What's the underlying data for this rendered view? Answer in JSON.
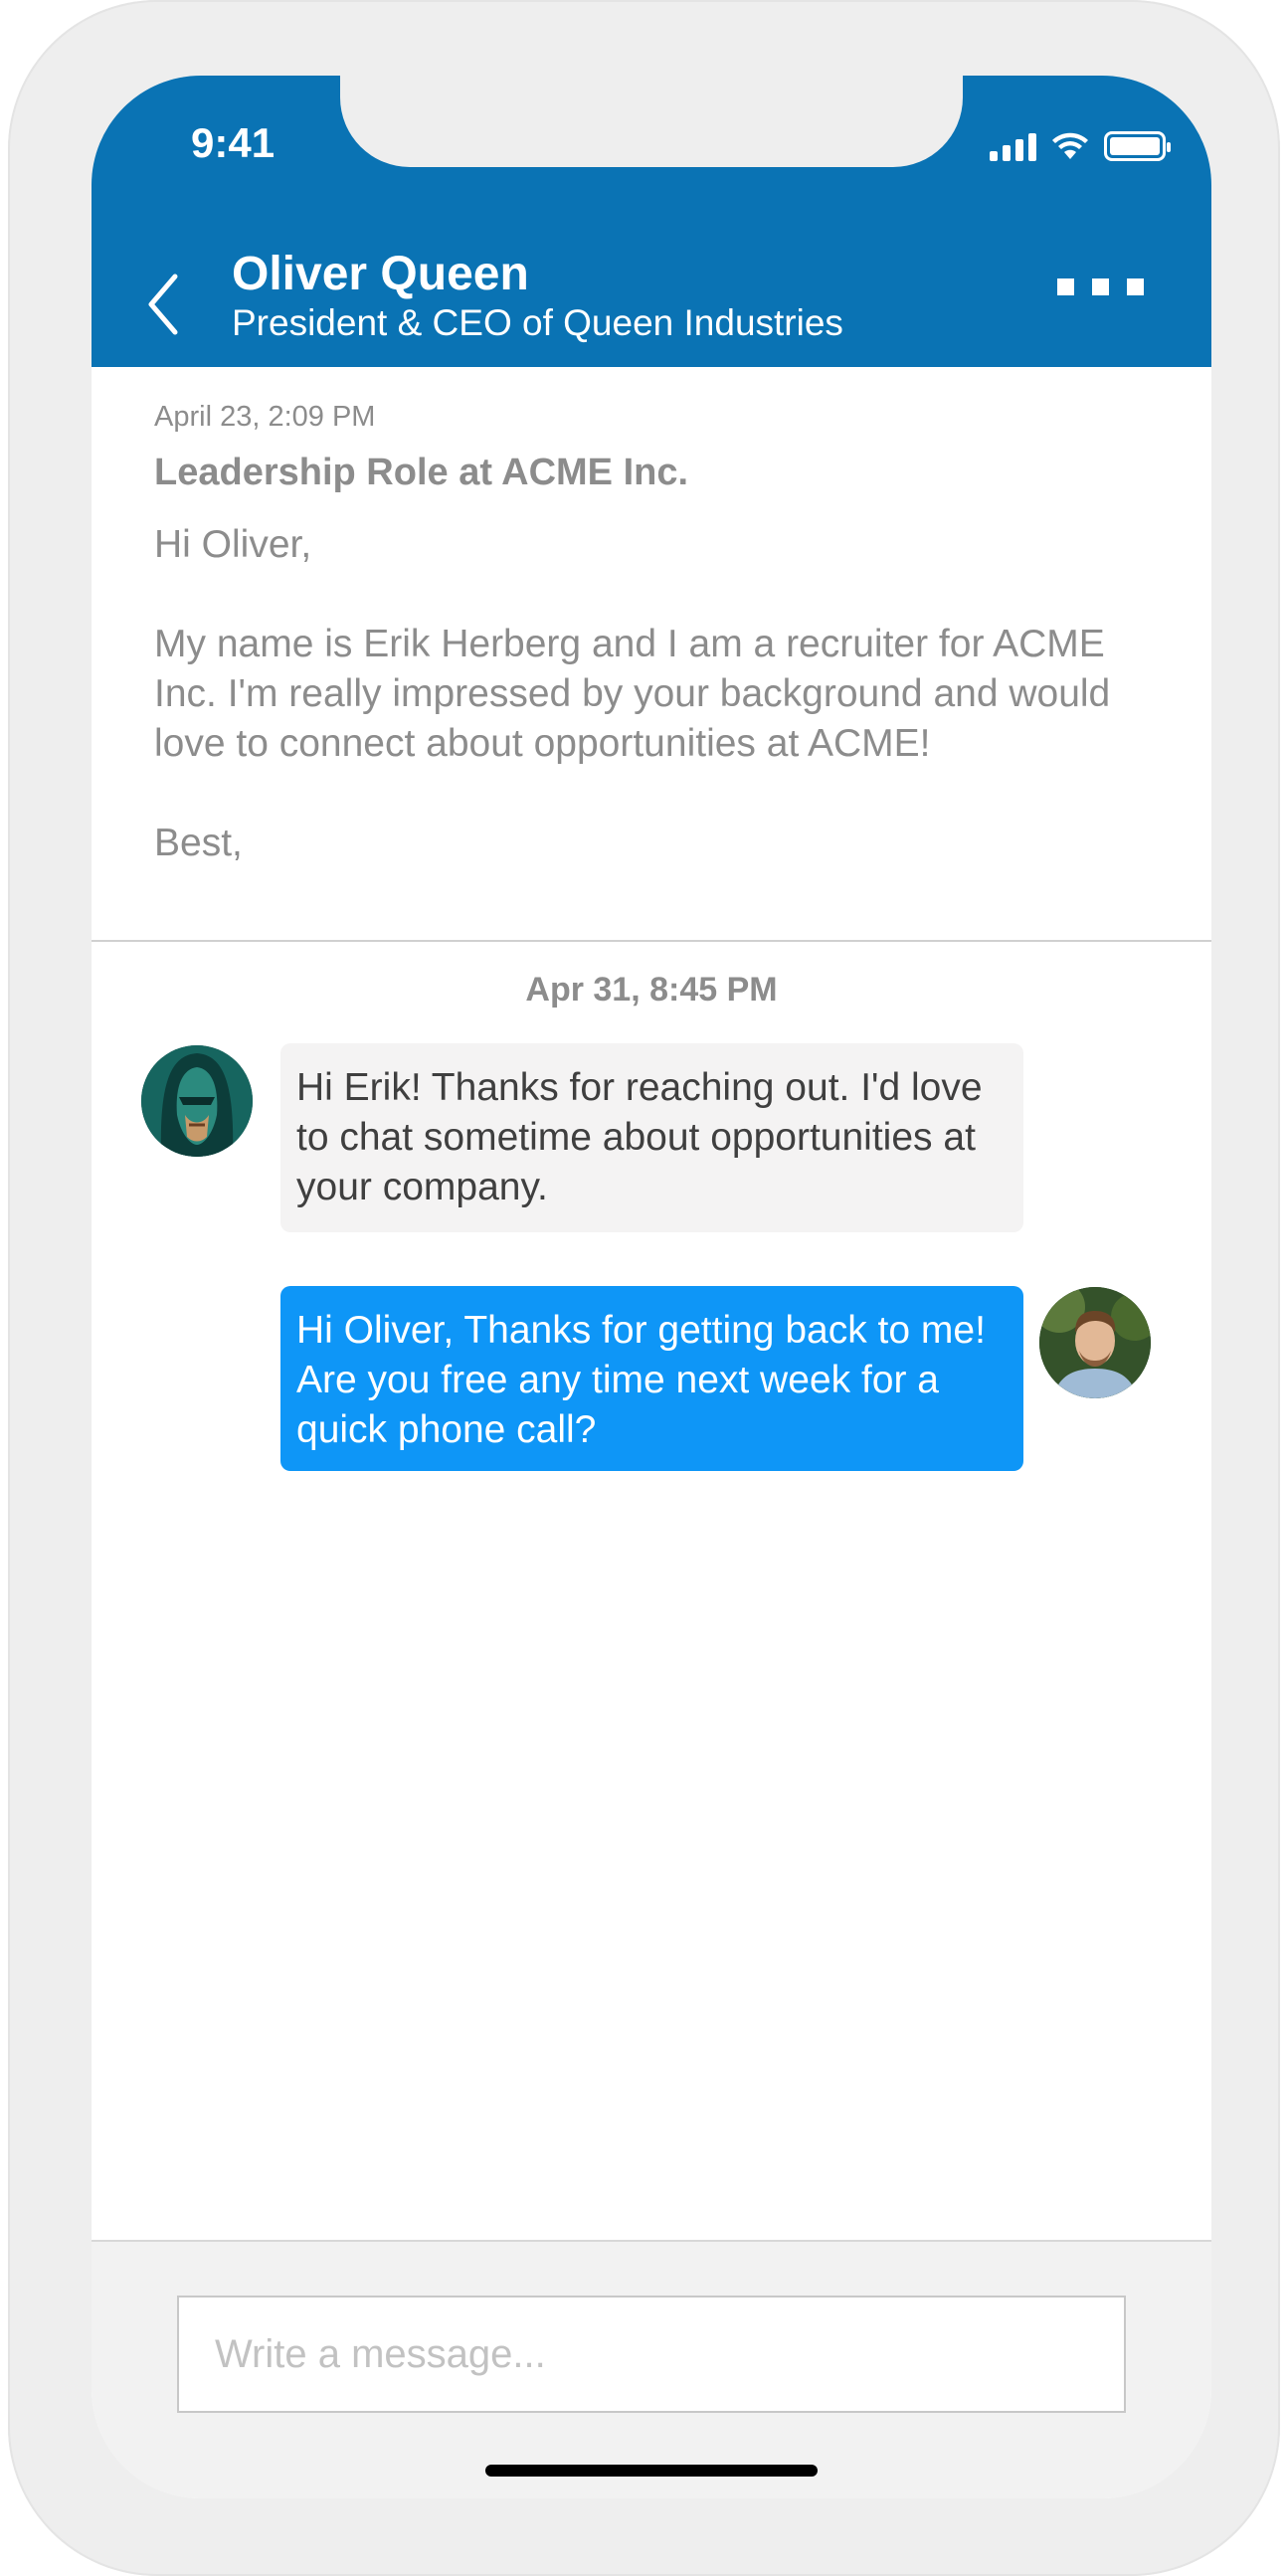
{
  "status_bar": {
    "time": "9:41"
  },
  "header": {
    "name": "Oliver Queen",
    "subtitle": "President & CEO of Queen Industries"
  },
  "intro_message": {
    "date": "April 23, 2:09 PM",
    "subject": "Leadership Role at ACME Inc.",
    "greeting": "Hi Oliver,",
    "body": "My name is Erik Herberg and I am a recruiter for ACME Inc. I'm really impressed by your background and would love to connect about opportunities at ACME!",
    "closing": "Best,"
  },
  "conversation": {
    "date": "Apr 31, 8:45 PM",
    "messages": [
      {
        "text": "Hi Erik! Thanks for reaching out. I'd love to chat sometime about opportunities at your company."
      },
      {
        "text": "Hi Oliver, Thanks for getting back to me! Are you free any time next week for a quick phone call?"
      }
    ]
  },
  "composer": {
    "placeholder": "Write a message..."
  },
  "colors": {
    "header": "#0a73b4",
    "outgoing_bubble": "#0e96f7",
    "incoming_bubble": "#f4f3f3"
  }
}
